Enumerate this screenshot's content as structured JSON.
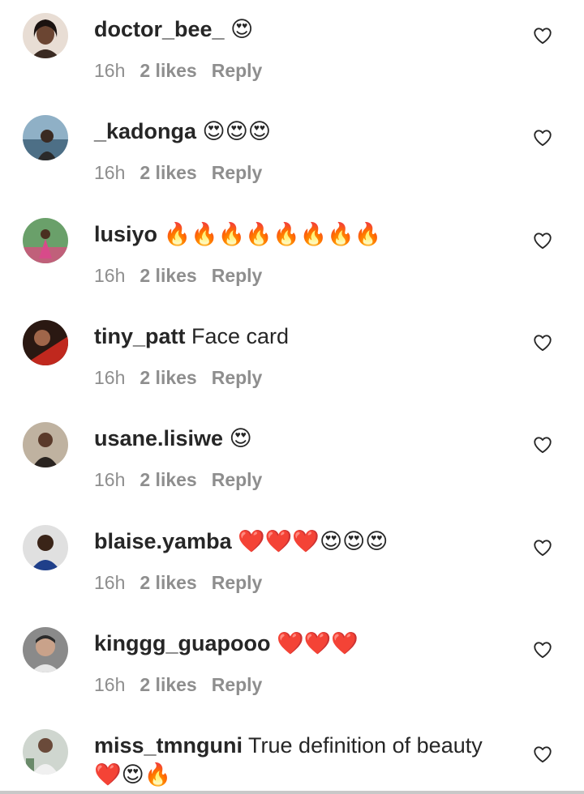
{
  "comments": [
    {
      "username": "doctor_bee_",
      "text": " 😍",
      "time": "16h",
      "likes": "2 likes",
      "reply": "Reply",
      "avatar_color": "#3a2a22"
    },
    {
      "username": "_kadonga",
      "text": " 😍😍😍",
      "time": "16h",
      "likes": "2 likes",
      "reply": "Reply",
      "avatar_color": "#4d6f86"
    },
    {
      "username": "lusiyo",
      "text": " 🔥🔥🔥🔥🔥🔥🔥🔥",
      "time": "16h",
      "likes": "2 likes",
      "reply": "Reply",
      "avatar_color": "#4c8a4c"
    },
    {
      "username": "tiny_patt",
      "text": " Face card",
      "time": "16h",
      "likes": "2 likes",
      "reply": "Reply",
      "avatar_color": "#8a2a20"
    },
    {
      "username": "usane.lisiwe",
      "text": " 😍",
      "time": "16h",
      "likes": "2 likes",
      "reply": "Reply",
      "avatar_color": "#7a6a5a"
    },
    {
      "username": "blaise.yamba",
      "text": " ❤️❤️❤️😍😍😍",
      "time": "16h",
      "likes": "2 likes",
      "reply": "Reply",
      "avatar_color": "#1f3f8a"
    },
    {
      "username": "kinggg_guapooo",
      "text": " ❤️❤️❤️",
      "time": "16h",
      "likes": "2 likes",
      "reply": "Reply",
      "avatar_color": "#6a6a6a"
    },
    {
      "username": "miss_tmnguni",
      "text": " True definition of beauty❤️😍🔥",
      "avatar_color": "#9aa89a"
    }
  ],
  "icons": {
    "like": "heart-outline-icon"
  }
}
